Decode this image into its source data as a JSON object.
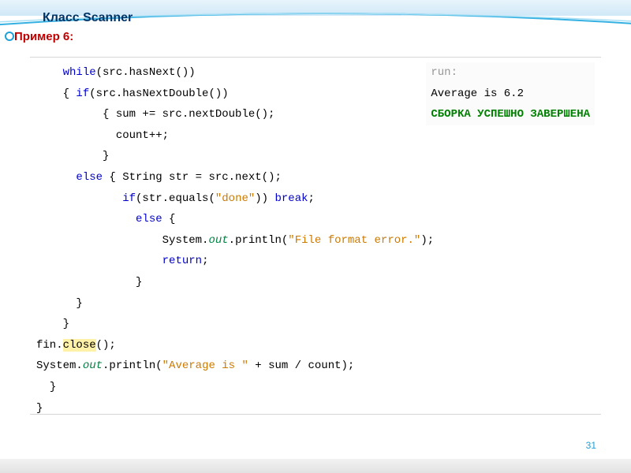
{
  "heading": "Класс Scanner",
  "subtitle": "Пример 6:",
  "page_number": "31",
  "output": {
    "run_label": "run:",
    "line1": "Average is 6.2",
    "line2": "СБОРКА УСПЕШНО ЗАВЕРШЕНА"
  },
  "code": {
    "kw_while": "while",
    "cond_hasNext": "(src.hasNext())",
    "lbrace": "{",
    "rbrace": "}",
    "kw_if": "if",
    "cond_hasNextDouble": "(src.hasNextDouble())",
    "stmt_sum": "{ sum += src.nextDouble();",
    "stmt_count": "count++;",
    "kw_else": "else",
    "stmt_str_decl": " { String str = src.next();",
    "cond_str_equals_pre": "(str.equals(",
    "lit_done": "\"done\"",
    "cond_str_equals_post": ")) ",
    "kw_break": "break",
    "semicolon": ";",
    "else_lbrace": " {",
    "sys": "System.",
    "out": "out",
    "println_err_pre": ".println(",
    "lit_err": "\"File format error.\"",
    "println_err_post": ");",
    "kw_return": "return",
    "stmt_fin": "fin.",
    "fin_close": "close",
    "fin_close_post": "();",
    "println_avg_pre": ".println(",
    "lit_avg": "\"Average is \"",
    "println_avg_post": " + sum / count);"
  }
}
